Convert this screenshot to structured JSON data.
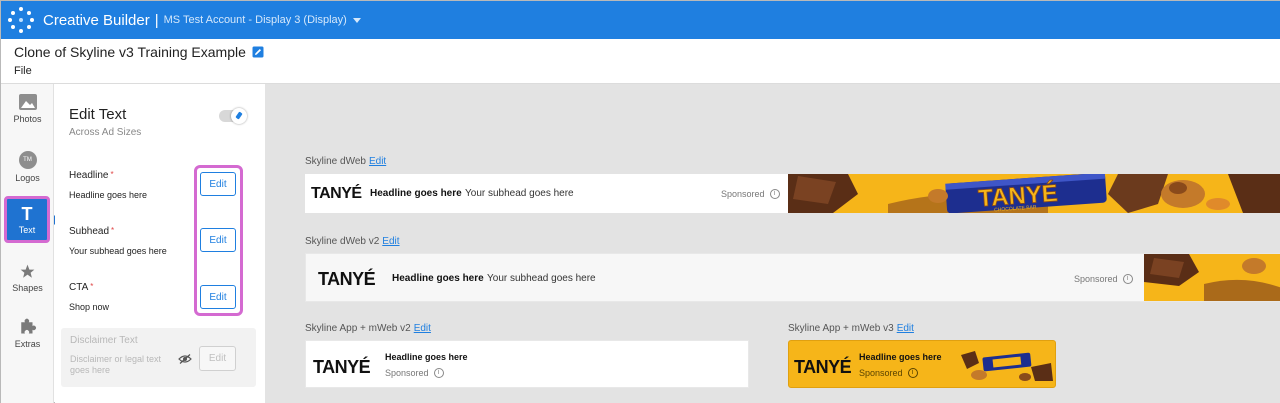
{
  "app": {
    "title": "Creative Builder",
    "separator": "|",
    "account": "MS Test Account - Display 3 (Display)"
  },
  "document": {
    "title": "Clone of Skyline v3 Training Example",
    "file_menu": "File"
  },
  "rail": {
    "photos": "Photos",
    "logos": "Logos",
    "logo_avatar": "TM",
    "text": "Text",
    "text_glyph": "T",
    "shapes": "Shapes",
    "extras": "Extras"
  },
  "panel": {
    "title": "Edit Text",
    "subtitle": "Across Ad Sizes",
    "fields": [
      {
        "label": "Headline",
        "required": "*",
        "value": "Headline goes here",
        "button": "Edit"
      },
      {
        "label": "Subhead",
        "required": "*",
        "value": "Your subhead goes here",
        "button": "Edit"
      },
      {
        "label": "CTA",
        "required": "*",
        "value": "Shop now",
        "button": "Edit"
      }
    ],
    "disclaimer": {
      "label": "Disclaimer Text",
      "placeholder": "Disclaimer or legal text goes here",
      "button": "Edit"
    }
  },
  "previews": [
    {
      "name": "Skyline dWeb",
      "edit": "Edit",
      "brand": "TANYÉ",
      "headline": "Headline goes here",
      "subhead": "Your subhead goes here",
      "sponsored": "Sponsored"
    },
    {
      "name": "Skyline dWeb v2",
      "edit": "Edit",
      "brand": "TANYÉ",
      "headline": "Headline goes here",
      "subhead": "Your subhead goes here",
      "sponsored": "Sponsored"
    },
    {
      "name": "Skyline App + mWeb v2",
      "edit": "Edit",
      "brand": "TANYÉ",
      "headline": "Headline goes here",
      "sponsored": "Sponsored"
    },
    {
      "name": "Skyline App + mWeb v3",
      "edit": "Edit",
      "brand": "TANYÉ",
      "headline": "Headline goes here",
      "sponsored": "Sponsored"
    }
  ],
  "banner": {
    "product_name": "TANYÉ",
    "product_tag": "CHOCOLATE BAR"
  },
  "colors": {
    "accent": "#1f7fe0",
    "highlight": "#d46ad1",
    "banner_yellow": "#f6b519"
  }
}
